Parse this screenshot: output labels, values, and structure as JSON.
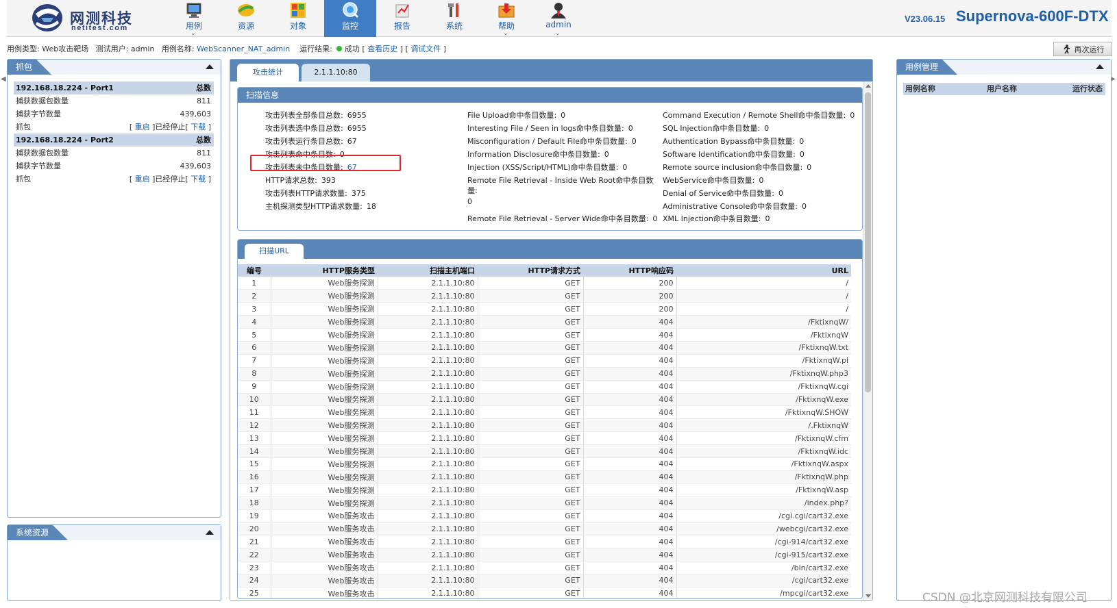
{
  "brand": {
    "name": "网测科技",
    "sub": "netitest.com"
  },
  "nav": [
    {
      "label": "用例",
      "icon": "case-icon",
      "dropdown": true
    },
    {
      "label": "资源",
      "icon": "resource-icon",
      "dropdown": false
    },
    {
      "label": "对象",
      "icon": "object-icon",
      "dropdown": false
    },
    {
      "label": "监控",
      "icon": "monitor-icon",
      "dropdown": false,
      "active": true
    },
    {
      "label": "报告",
      "icon": "report-icon",
      "dropdown": false
    },
    {
      "label": "系统",
      "icon": "system-icon",
      "dropdown": false
    },
    {
      "label": "帮助",
      "icon": "help-icon",
      "dropdown": true
    },
    {
      "label": "admin",
      "icon": "user-icon",
      "dropdown": true
    }
  ],
  "header": {
    "version": "V23.06.15",
    "product": "Supernova-600F-DTX"
  },
  "info": {
    "type_label": "用例类型:",
    "type_value": "Web攻击靶场",
    "user_label": "测试用户:",
    "user_value": "admin",
    "case_label": "用例名称:",
    "case_value": "WebScanner_NAT_admin",
    "result_label": "运行结果:",
    "result_value": "成功",
    "history_link": "查看历史",
    "debug_link": "调试文件",
    "rerun_button": "再次运行"
  },
  "capture": {
    "title": "抓包",
    "ports": [
      {
        "name": "192.168.18.224 - Port1",
        "total_label": "总数",
        "packets_label": "捕获数据包数量",
        "packets": "811",
        "bytes_label": "捕获字节数量",
        "bytes": "439,603",
        "cap_label": "抓包",
        "restart": "重启",
        "stopped": "已经停止",
        "download": "下载"
      },
      {
        "name": "192.168.18.224 - Port2",
        "total_label": "总数",
        "packets_label": "捕获数据包数量",
        "packets": "811",
        "bytes_label": "捕获字节数量",
        "bytes": "439,603",
        "cap_label": "抓包",
        "restart": "重启",
        "stopped": "已经停止",
        "download": "下载"
      }
    ]
  },
  "sysres": {
    "title": "系统资源"
  },
  "tabs": {
    "stats": "攻击统计",
    "host": "2.1.1.10:80"
  },
  "scan": {
    "title": "扫描信息",
    "col1": [
      {
        "label": "攻击列表全部条目总数:",
        "value": "6955"
      },
      {
        "label": "攻击列表选中条目总数:",
        "value": "6955"
      },
      {
        "label": "攻击列表运行条目总数:",
        "value": "67"
      },
      {
        "label": "攻击列表命中条目数:",
        "value": "0"
      },
      {
        "label": "攻击列表未中条目数量:",
        "value": "67"
      },
      {
        "label": "HTTP请求总数:",
        "value": "393"
      },
      {
        "label": "攻击列表HTTP请求数量:",
        "value": "375"
      },
      {
        "label": "主机探测类型HTTP请求数量:",
        "value": "18"
      }
    ],
    "col2": [
      {
        "label": "File Upload命中条目数量:",
        "value": "0"
      },
      {
        "label": "Interesting File / Seen in logs命中条目数量:",
        "value": "0"
      },
      {
        "label": "Misconfiguration / Default File命中条目数量:",
        "value": "0"
      },
      {
        "label": "Information Disclosure命中条目数量:",
        "value": "0"
      },
      {
        "label": "Injection (XSS/Script/HTML)命中条目数量:",
        "value": "0"
      },
      {
        "label": "Remote File Retrieval - Inside Web Root命中条目数",
        "label2": "量:",
        "value": "0"
      },
      {
        "label": "Remote File Retrieval - Server Wide命中条目数量:",
        "value": "0"
      }
    ],
    "col3": [
      {
        "label": "Command Execution / Remote Shell命中条目数量:",
        "value": "0"
      },
      {
        "label": "SQL Injection命中条目数量:",
        "value": "0"
      },
      {
        "label": "Authentication Bypass命中条目数量:",
        "value": "0"
      },
      {
        "label": "Software Identification命中条目数量:",
        "value": "0"
      },
      {
        "label": "Remote source inclusion命中条目数量:",
        "value": "0"
      },
      {
        "label": "WebService命中条目数量:",
        "value": "0"
      },
      {
        "label": "Denial of Service命中条目数量:",
        "value": "0"
      },
      {
        "label": "Administrative Console命中条目数量:",
        "value": "0"
      },
      {
        "label": "XML Injection命中条目数量:",
        "value": "0"
      }
    ]
  },
  "urls": {
    "tab": "扫描URL",
    "headers": [
      "编号",
      "HTTP服务类型",
      "扫描主机端口",
      "HTTP请求方式",
      "HTTP响应码",
      "URL"
    ],
    "rows": [
      [
        "1",
        "Web服务探测",
        "2.1.1.10:80",
        "GET",
        "200",
        "/"
      ],
      [
        "2",
        "Web服务探测",
        "2.1.1.10:80",
        "GET",
        "200",
        "/"
      ],
      [
        "3",
        "Web服务探测",
        "2.1.1.10:80",
        "GET",
        "200",
        "/"
      ],
      [
        "4",
        "Web服务探测",
        "2.1.1.10:80",
        "GET",
        "404",
        "/FktixnqW/"
      ],
      [
        "5",
        "Web服务探测",
        "2.1.1.10:80",
        "GET",
        "404",
        "/FktixnqW"
      ],
      [
        "6",
        "Web服务探测",
        "2.1.1.10:80",
        "GET",
        "404",
        "/FktixnqW.txt"
      ],
      [
        "7",
        "Web服务探测",
        "2.1.1.10:80",
        "GET",
        "404",
        "/FktixnqW.pl"
      ],
      [
        "8",
        "Web服务探测",
        "2.1.1.10:80",
        "GET",
        "404",
        "/FktixnqW.php3"
      ],
      [
        "9",
        "Web服务探测",
        "2.1.1.10:80",
        "GET",
        "404",
        "/FktixnqW.cgi"
      ],
      [
        "10",
        "Web服务探测",
        "2.1.1.10:80",
        "GET",
        "404",
        "/FktixnqW.exe"
      ],
      [
        "11",
        "Web服务探测",
        "2.1.1.10:80",
        "GET",
        "404",
        "/FktixnqW.SHOW"
      ],
      [
        "12",
        "Web服务探测",
        "2.1.1.10:80",
        "GET",
        "404",
        "/.FktixnqW"
      ],
      [
        "13",
        "Web服务探测",
        "2.1.1.10:80",
        "GET",
        "404",
        "/FktixnqW.cfm"
      ],
      [
        "14",
        "Web服务探测",
        "2.1.1.10:80",
        "GET",
        "404",
        "/FktixnqW.idc"
      ],
      [
        "15",
        "Web服务探测",
        "2.1.1.10:80",
        "GET",
        "404",
        "/FktixnqW.aspx"
      ],
      [
        "16",
        "Web服务探测",
        "2.1.1.10:80",
        "GET",
        "404",
        "/FktixnqW.php"
      ],
      [
        "17",
        "Web服务探测",
        "2.1.1.10:80",
        "GET",
        "404",
        "/FktixnqW.asp"
      ],
      [
        "18",
        "Web服务探测",
        "2.1.1.10:80",
        "GET",
        "404",
        "/index.php?"
      ],
      [
        "19",
        "Web服务攻击",
        "2.1.1.10:80",
        "GET",
        "404",
        "/cgi.cgi/cart32.exe"
      ],
      [
        "20",
        "Web服务攻击",
        "2.1.1.10:80",
        "GET",
        "404",
        "/webcgi/cart32.exe"
      ],
      [
        "21",
        "Web服务攻击",
        "2.1.1.10:80",
        "GET",
        "404",
        "/cgi-914/cart32.exe"
      ],
      [
        "22",
        "Web服务攻击",
        "2.1.1.10:80",
        "GET",
        "404",
        "/cgi-915/cart32.exe"
      ],
      [
        "23",
        "Web服务攻击",
        "2.1.1.10:80",
        "GET",
        "404",
        "/bin/cart32.exe"
      ],
      [
        "24",
        "Web服务攻击",
        "2.1.1.10:80",
        "GET",
        "404",
        "/cgi/cart32.exe"
      ],
      [
        "25",
        "Web服务攻击",
        "2.1.1.10:80",
        "GET",
        "404",
        "/mpcgi/cart32.exe"
      ]
    ]
  },
  "cases": {
    "title": "用例管理",
    "cols": [
      "用例名称",
      "用户名称",
      "运行状态"
    ]
  },
  "watermark": "CSDN @北京网测科技有限公司"
}
